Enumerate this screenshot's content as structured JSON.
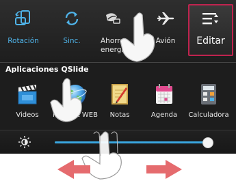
{
  "quick_settings": {
    "toggles": [
      {
        "label": "Rotación",
        "icon": "rotation-icon",
        "state": "on"
      },
      {
        "label": "Sinc.",
        "icon": "sync-icon",
        "state": "on"
      },
      {
        "label": "Ahorro energía",
        "icon": "battery-saver-icon",
        "state": "off"
      },
      {
        "label": "Avión",
        "icon": "airplane-icon",
        "state": "off"
      }
    ],
    "edit": {
      "label": "Editar",
      "icon": "edit-list-icon"
    }
  },
  "qslide": {
    "title": "Aplicaciones QSlide",
    "apps": [
      {
        "label": "Videos",
        "icon": "video-clapper-icon"
      },
      {
        "label": "Internet WEB",
        "icon": "globe-icon"
      },
      {
        "label": "Notas",
        "icon": "notepad-icon"
      },
      {
        "label": "Agenda",
        "icon": "calendar-icon"
      },
      {
        "label": "Calculadora",
        "icon": "calculator-icon"
      }
    ]
  },
  "brightness": {
    "icon": "brightness-icon",
    "level": 0.98
  },
  "colors": {
    "accent_blue": "#3aa7e0",
    "label_blue": "#4fb3e8",
    "edit_border": "#c0234f",
    "arrow_red": "#e56b6e"
  }
}
